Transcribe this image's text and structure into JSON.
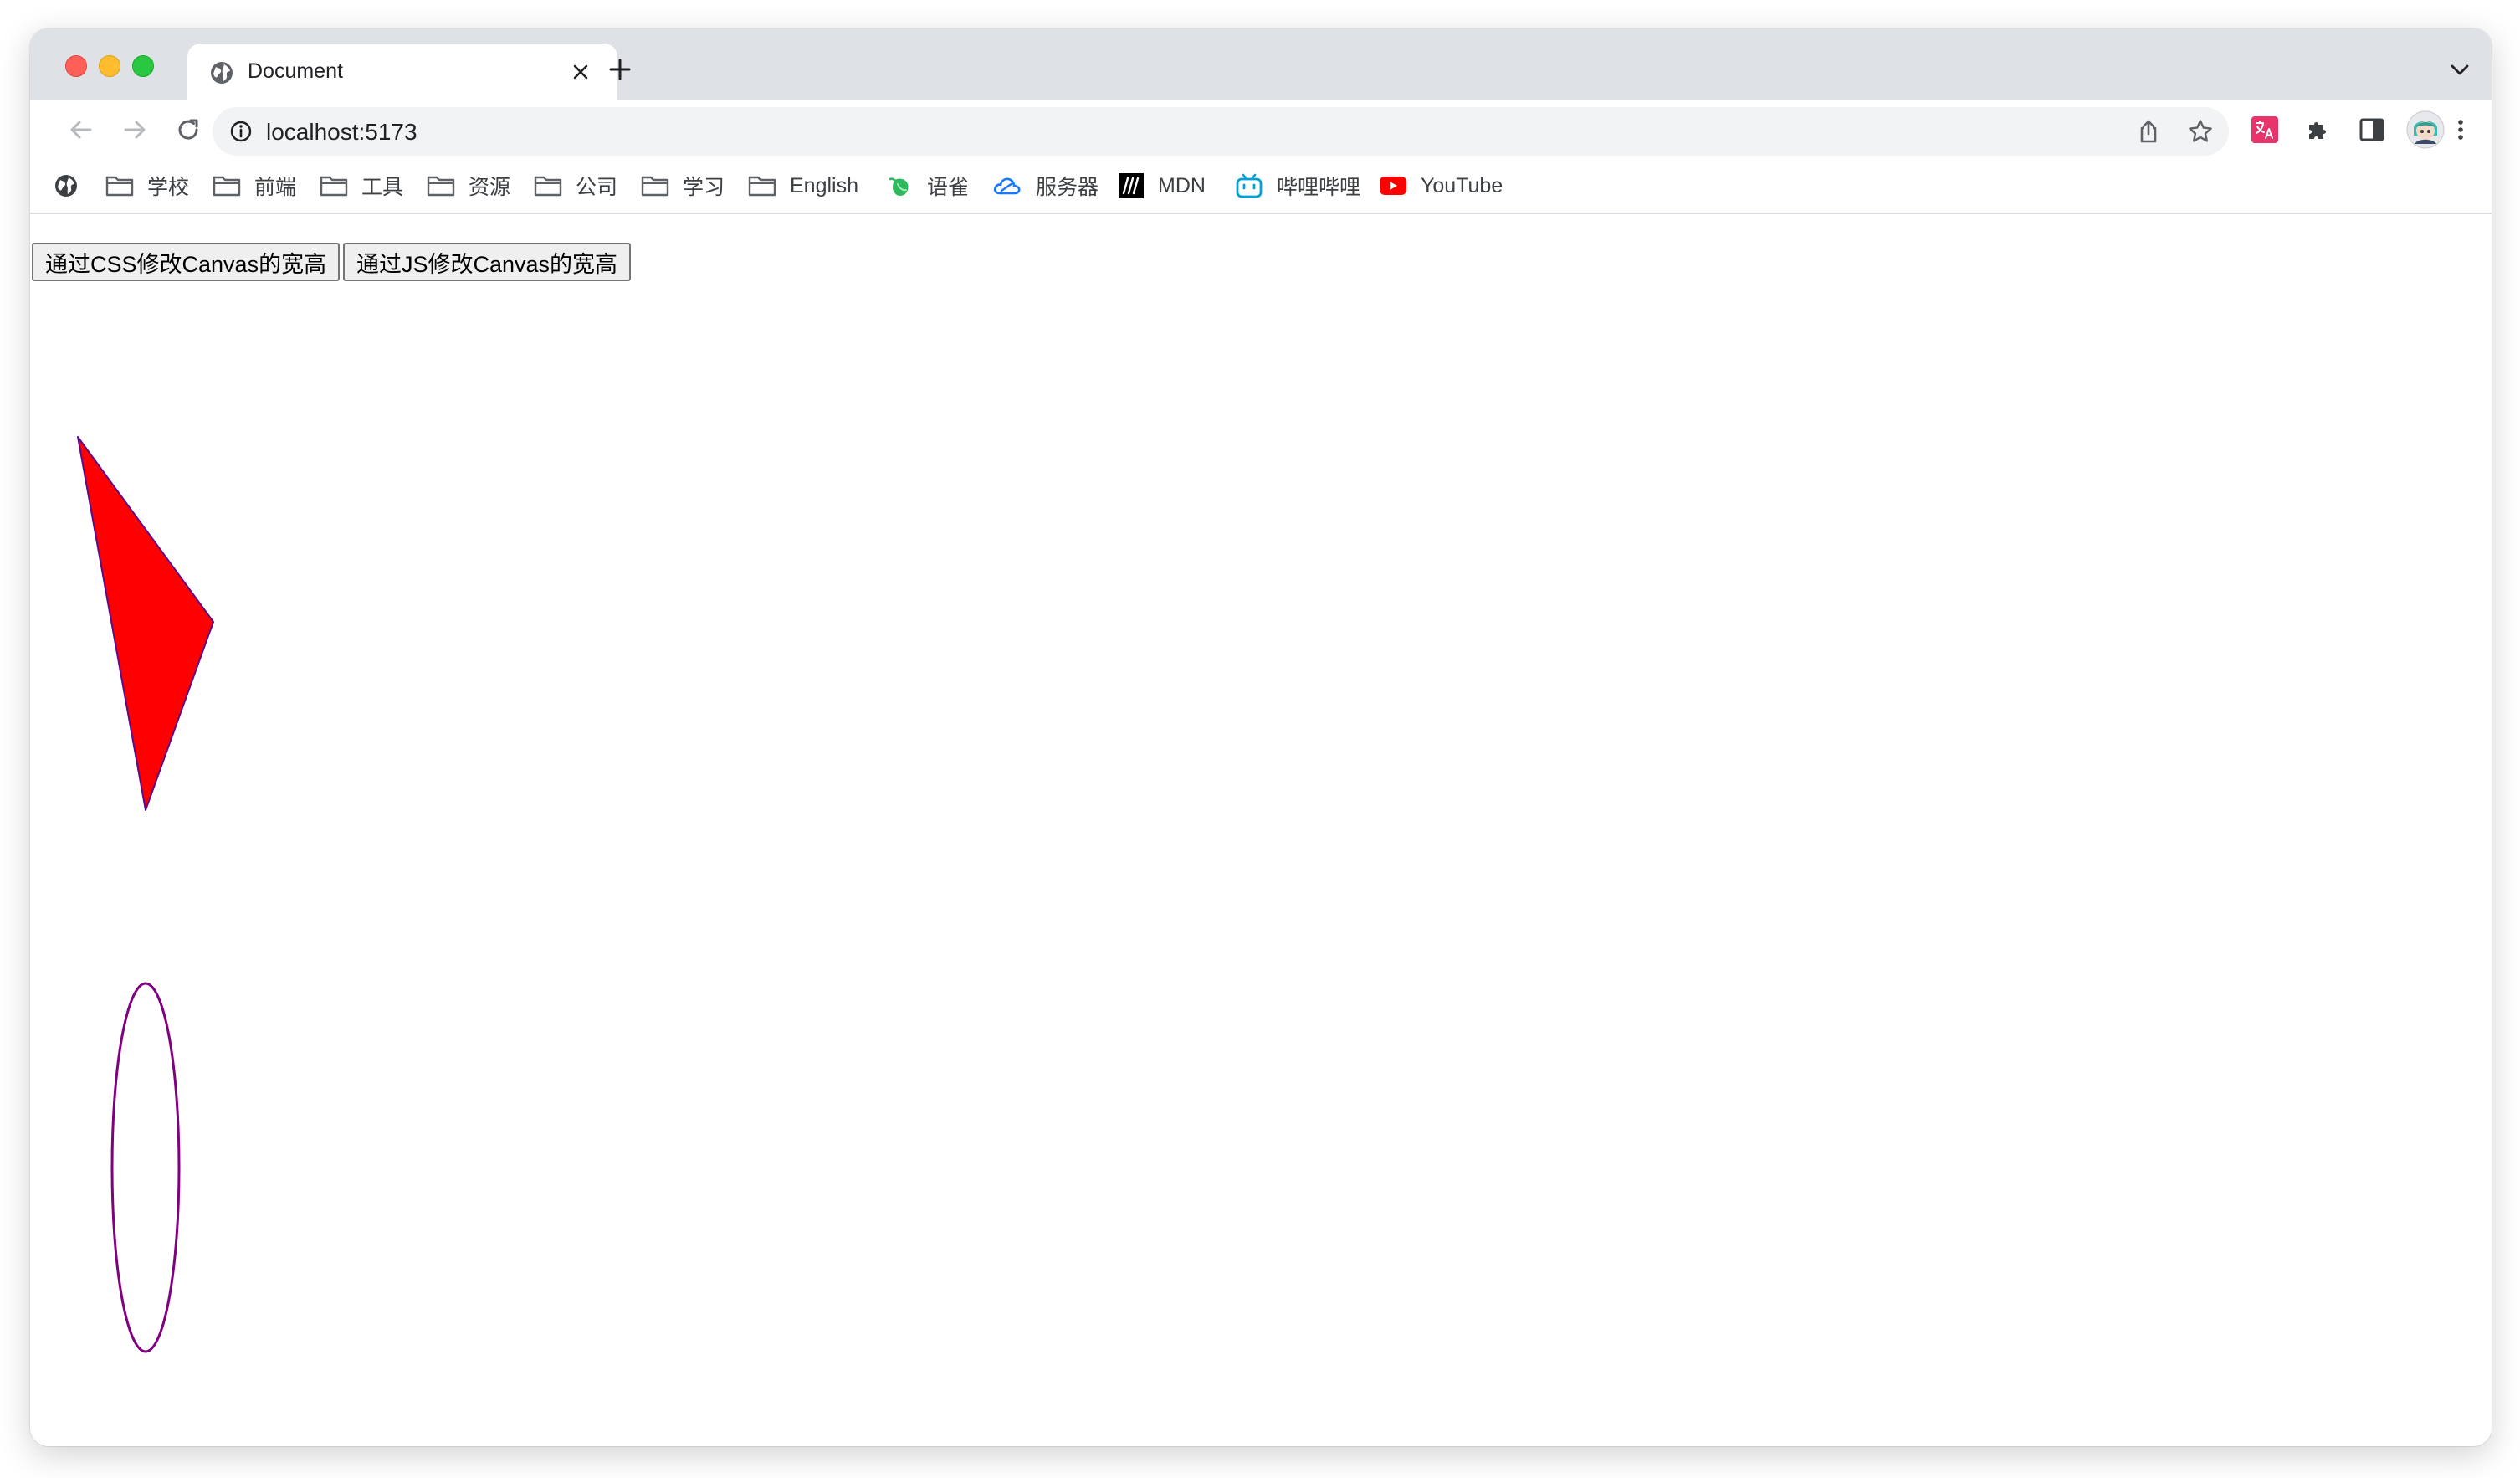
{
  "browser": {
    "tab": {
      "title": "Document",
      "favicon": "globe-icon"
    },
    "address_bar": {
      "url": "localhost:5173"
    },
    "bookmarks": [
      {
        "label": "",
        "icon": "globe-icon"
      },
      {
        "label": "学校",
        "icon": "folder-icon"
      },
      {
        "label": "前端",
        "icon": "folder-icon"
      },
      {
        "label": "工具",
        "icon": "folder-icon"
      },
      {
        "label": "资源",
        "icon": "folder-icon"
      },
      {
        "label": "公司",
        "icon": "folder-icon"
      },
      {
        "label": "学习",
        "icon": "folder-icon"
      },
      {
        "label": "English",
        "icon": "folder-icon"
      },
      {
        "label": "语雀",
        "icon": "yuque-icon"
      },
      {
        "label": "服务器",
        "icon": "cloud-icon"
      },
      {
        "label": "MDN",
        "icon": "mdn-icon"
      },
      {
        "label": "哔哩哔哩",
        "icon": "bilibili-icon"
      },
      {
        "label": "YouTube",
        "icon": "youtube-icon"
      }
    ]
  },
  "page": {
    "buttons": {
      "css_resize": "通过CSS修改Canvas的宽高",
      "js_resize": "通过JS修改Canvas的宽高"
    },
    "shapes": {
      "triangle_fill": "#ff0000",
      "triangle_stroke": "#5a0a8c",
      "ellipse_stroke": "#800080"
    }
  },
  "colors": {
    "tabstrip": "#dee1e6",
    "omnibox": "#f1f3f4",
    "youtube": "#ff0000",
    "bilibili": "#00a1d6",
    "yuque": "#2fb95e"
  }
}
